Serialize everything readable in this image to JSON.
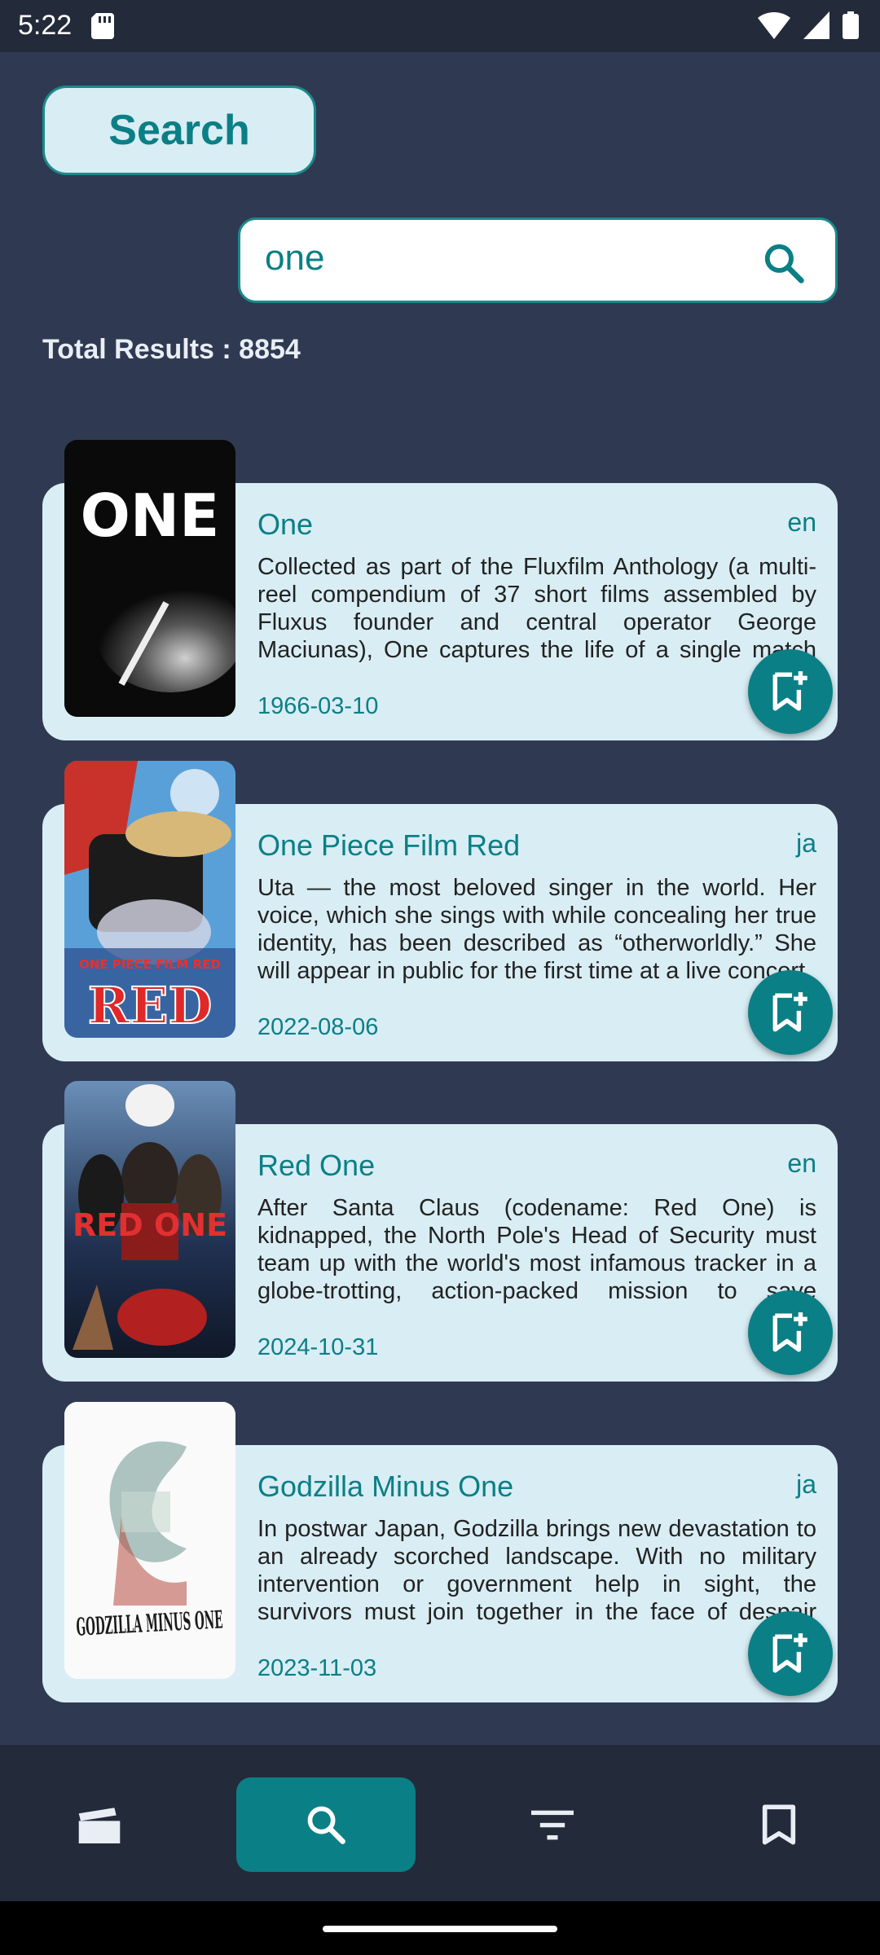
{
  "status": {
    "time": "5:22",
    "icons": [
      "sd-card-icon",
      "wifi-icon",
      "signal-icon",
      "battery-icon"
    ]
  },
  "header": {
    "title": "Search"
  },
  "search": {
    "value": "one"
  },
  "results": {
    "total_label": "Total Results : 8854"
  },
  "movies": [
    {
      "title": "One",
      "lang": "en",
      "overview": "Collected as part of the Fluxfilm Anthology (a multi-reel compendium of 37 short films assembled by Fluxus founder and central operator George Maciunas), One captures the life of a single match burning out.",
      "date": "1966-03-10",
      "poster_text": "ONE"
    },
    {
      "title": "One Piece Film Red",
      "lang": "ja",
      "overview": "Uta — the most beloved singer in the world. Her voice, which she sings with while concealing her true identity, has been described as “otherworldly.” She will appear in public for the first time at a live concert.",
      "date": "2022-08-06",
      "poster_text": "ONE PIECE FILM RED"
    },
    {
      "title": "Red One",
      "lang": "en",
      "overview": "After Santa Claus (codename: Red One) is kidnapped, the North Pole's Head of Security must team up with the world's most infamous tracker in a globe-trotting, action-packed mission to save Christmas.",
      "date": "2024-10-31",
      "poster_text": "RED ONE"
    },
    {
      "title": "Godzilla Minus One",
      "lang": "ja",
      "overview": "In postwar Japan, Godzilla brings new devastation to an already scorched landscape. With no military intervention or government help in sight, the survivors must join together in the face of despair and fight back against an unrelenting horror.",
      "date": "2023-11-03",
      "poster_text": "GODZILLA MINUS ONE"
    }
  ],
  "nav": {
    "items": [
      "movies-icon",
      "search-icon",
      "filter-icon",
      "bookmark-icon"
    ],
    "active": "search-icon"
  },
  "colors": {
    "background": "#2f3a52",
    "accent": "#0b7f86",
    "card": "#d9edf4",
    "bar": "#232a3a"
  }
}
